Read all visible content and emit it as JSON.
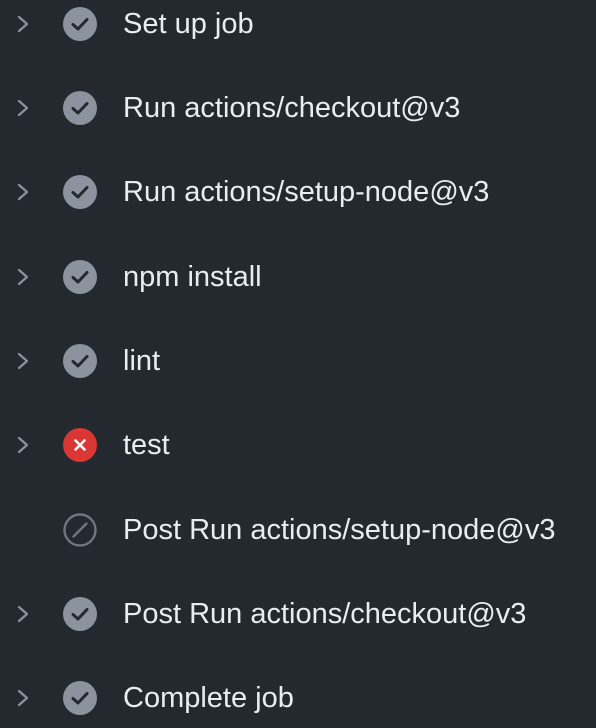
{
  "colors": {
    "background": "#24292f",
    "text": "#e6edf3",
    "chevron": "#8b949e",
    "success": "#8b949e",
    "failure": "#da3633",
    "skipped": "#6e7681"
  },
  "steps": [
    {
      "label": "Set up job",
      "status": "success",
      "icon": "check-circle-icon",
      "expandable": true
    },
    {
      "label": "Run actions/checkout@v3",
      "status": "success",
      "icon": "check-circle-icon",
      "expandable": true
    },
    {
      "label": "Run actions/setup-node@v3",
      "status": "success",
      "icon": "check-circle-icon",
      "expandable": true
    },
    {
      "label": "npm install",
      "status": "success",
      "icon": "check-circle-icon",
      "expandable": true
    },
    {
      "label": "lint",
      "status": "success",
      "icon": "check-circle-icon",
      "expandable": true
    },
    {
      "label": "test",
      "status": "failure",
      "icon": "x-circle-icon",
      "expandable": true
    },
    {
      "label": "Post Run actions/setup-node@v3",
      "status": "skipped",
      "icon": "skip-icon",
      "expandable": false
    },
    {
      "label": "Post Run actions/checkout@v3",
      "status": "success",
      "icon": "check-circle-icon",
      "expandable": true
    },
    {
      "label": "Complete job",
      "status": "success",
      "icon": "check-circle-icon",
      "expandable": true
    }
  ]
}
